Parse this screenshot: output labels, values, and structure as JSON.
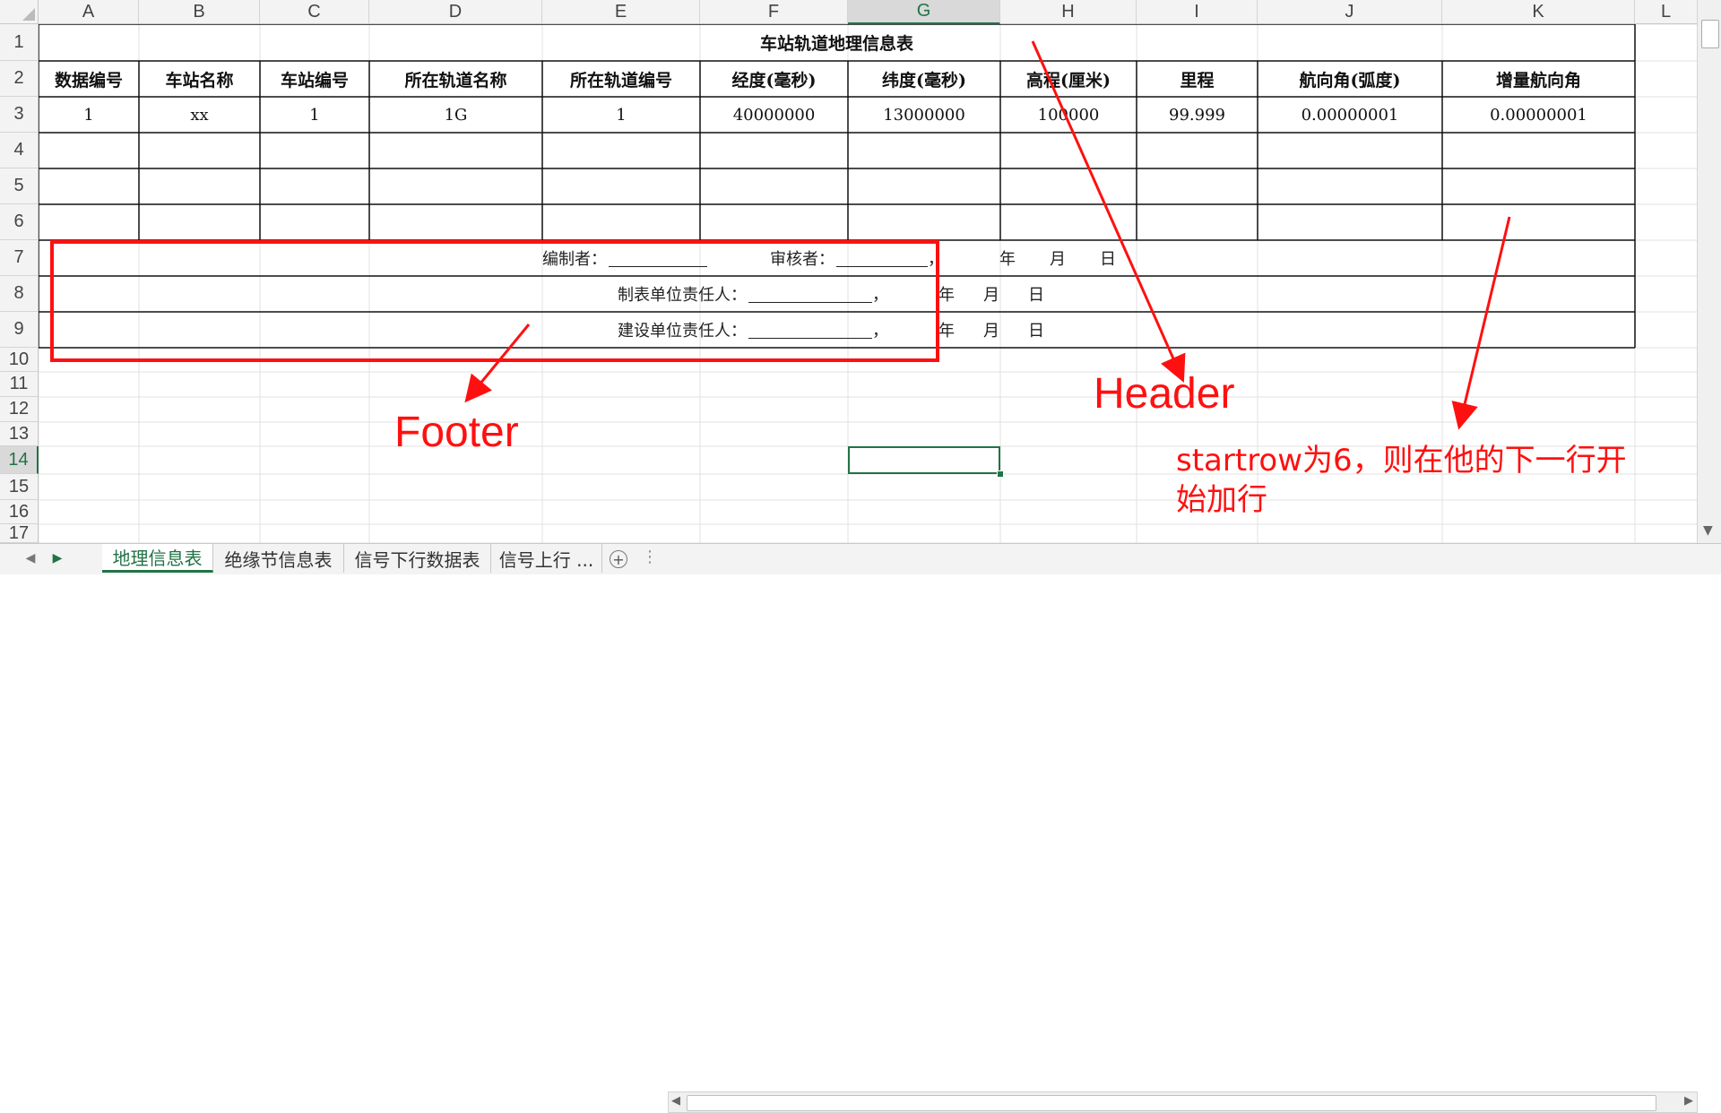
{
  "columns": [
    "A",
    "B",
    "C",
    "D",
    "E",
    "F",
    "G",
    "H",
    "I",
    "J",
    "K",
    "L"
  ],
  "rows": [
    "1",
    "2",
    "3",
    "4",
    "5",
    "6",
    "7",
    "8",
    "9",
    "10",
    "11",
    "12",
    "13",
    "14",
    "15",
    "16",
    "17"
  ],
  "selected": {
    "column": "G",
    "row": "14"
  },
  "table": {
    "title": "车站轨道地理信息表",
    "headers": [
      "数据编号",
      "车站名称",
      "车站编号",
      "所在轨道名称",
      "所在轨道编号",
      "经度(毫秒)",
      "纬度(毫秒)",
      "高程(厘米)",
      "里程",
      "航向角(弧度)",
      "增量航向角"
    ],
    "data_row": [
      "1",
      "xx",
      "1",
      "1G",
      "1",
      "40000000",
      "13000000",
      "100000",
      "99.999",
      "0.00000001",
      "0.00000001"
    ]
  },
  "footer": {
    "compiler_label": "编制者：",
    "reviewer_label": "审核者：",
    "comma": "，",
    "year": "年",
    "month": "月",
    "day": "日",
    "table_unit_label": "制表单位责任人：",
    "construction_unit_label": "建设单位责任人："
  },
  "annotations": {
    "footer": "Footer",
    "header": "Header",
    "startrow_line1": "startrow为6，则在他的下一行开",
    "startrow_line2": "始加行",
    "color": "#ff1010"
  },
  "sheet_tabs": [
    "地理信息表",
    "绝缘节信息表",
    "信号下行数据表",
    "信号上行 ..."
  ],
  "active_tab": "地理信息表",
  "add_sheet_icon": "plus-circle-icon",
  "accent_color": "#217346"
}
